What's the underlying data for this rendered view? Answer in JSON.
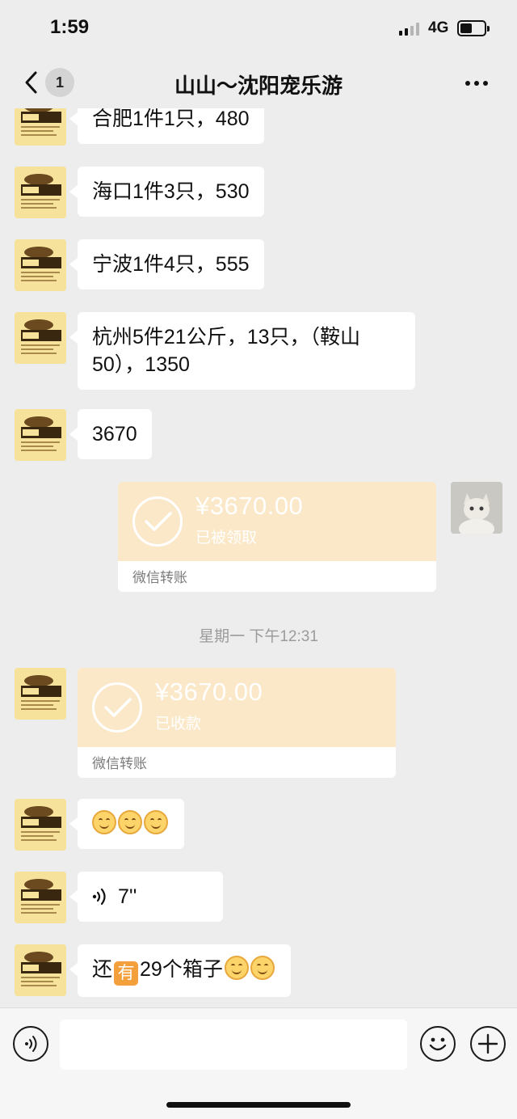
{
  "status_bar": {
    "time": "1:59",
    "network": "4G"
  },
  "nav": {
    "back_icon": "chevron-left-icon",
    "unread_count": "1",
    "title": "山山～沈阳宠乐游",
    "more_icon": "more-dots-icon"
  },
  "messages": [
    {
      "text": "合肥1件1只，480"
    },
    {
      "text": "海口1件3只，530"
    },
    {
      "text": "宁波1件4只，555"
    },
    {
      "text": "杭州5件21公斤，13只，（鞍山50），1350"
    },
    {
      "text": "3670"
    }
  ],
  "transfer_sent": {
    "amount": "¥3670.00",
    "status": "已被领取",
    "label": "微信转账"
  },
  "timestamp": "星期一 下午12:31",
  "transfer_received": {
    "amount": "¥3670.00",
    "status": "已收款",
    "label": "微信转账"
  },
  "voice_message": {
    "duration": "7''"
  },
  "last_message": {
    "prefix": "还",
    "badge": "有",
    "suffix": "29个箱子"
  },
  "input_bar": {
    "voice_icon": "voice-mode-icon",
    "emoji_icon": "emoji-icon",
    "plus_icon": "plus-icon"
  },
  "colors": {
    "background": "#ededed",
    "bubble": "#ffffff",
    "transfer": "#fbe8c8",
    "avatar_bg": "#f6e29a"
  }
}
